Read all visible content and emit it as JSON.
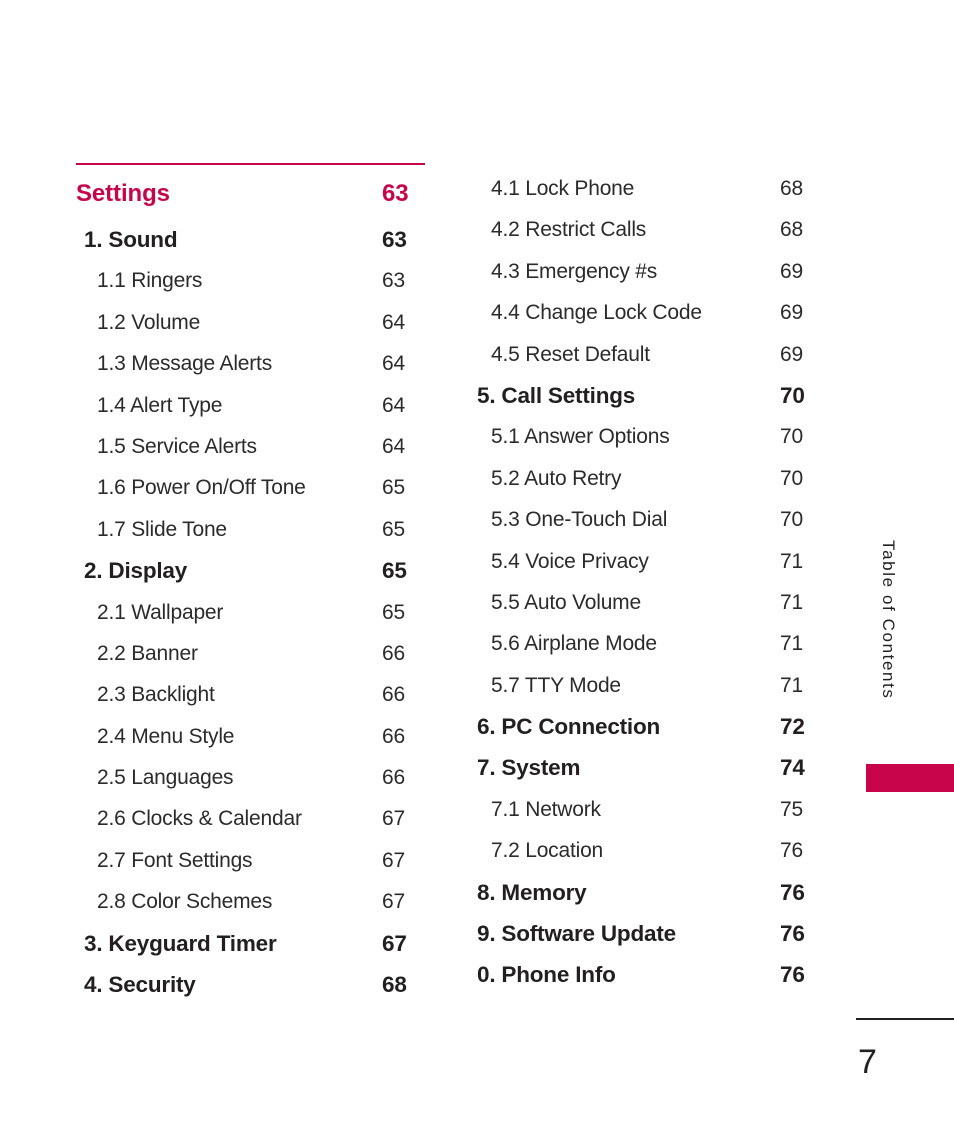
{
  "document": {
    "side_tab_label": "Table of Contents",
    "footer_page_number": "7",
    "accent_color": "#c8054b",
    "text_color": "#231f20"
  },
  "columns": {
    "left": [
      {
        "level": 0,
        "label": "Settings",
        "page": "63"
      },
      {
        "level": 1,
        "label": "1. Sound",
        "page": "63"
      },
      {
        "level": 2,
        "label": "1.1 Ringers",
        "page": "63"
      },
      {
        "level": 2,
        "label": "1.2 Volume",
        "page": "64"
      },
      {
        "level": 2,
        "label": "1.3 Message Alerts",
        "page": "64"
      },
      {
        "level": 2,
        "label": "1.4 Alert Type",
        "page": "64"
      },
      {
        "level": 2,
        "label": "1.5 Service Alerts",
        "page": "64"
      },
      {
        "level": 2,
        "label": "1.6 Power On/Off Tone",
        "page": "65"
      },
      {
        "level": 2,
        "label": "1.7 Slide Tone",
        "page": "65"
      },
      {
        "level": 1,
        "label": "2. Display",
        "page": "65"
      },
      {
        "level": 2,
        "label": "2.1 Wallpaper",
        "page": "65"
      },
      {
        "level": 2,
        "label": "2.2 Banner",
        "page": "66"
      },
      {
        "level": 2,
        "label": "2.3 Backlight",
        "page": "66"
      },
      {
        "level": 2,
        "label": "2.4 Menu Style",
        "page": "66"
      },
      {
        "level": 2,
        "label": "2.5 Languages",
        "page": "66"
      },
      {
        "level": 2,
        "label": "2.6 Clocks & Calendar",
        "page": "67"
      },
      {
        "level": 2,
        "label": "2.7 Font Settings",
        "page": "67"
      },
      {
        "level": 2,
        "label": "2.8 Color Schemes",
        "page": "67"
      },
      {
        "level": 1,
        "label": "3. Keyguard Timer",
        "page": "67"
      },
      {
        "level": 1,
        "label": "4. Security",
        "page": "68"
      }
    ],
    "right": [
      {
        "level": 2,
        "label": "4.1 Lock Phone",
        "page": "68"
      },
      {
        "level": 2,
        "label": "4.2 Restrict Calls",
        "page": "68"
      },
      {
        "level": 2,
        "label": "4.3 Emergency #s",
        "page": "69"
      },
      {
        "level": 2,
        "label": "4.4 Change Lock Code",
        "page": "69"
      },
      {
        "level": 2,
        "label": "4.5 Reset Default",
        "page": "69"
      },
      {
        "level": 1,
        "label": "5. Call Settings",
        "page": "70"
      },
      {
        "level": 2,
        "label": "5.1 Answer Options",
        "page": "70"
      },
      {
        "level": 2,
        "label": "5.2 Auto Retry",
        "page": "70"
      },
      {
        "level": 2,
        "label": "5.3 One-Touch Dial",
        "page": "70"
      },
      {
        "level": 2,
        "label": "5.4 Voice Privacy",
        "page": "71"
      },
      {
        "level": 2,
        "label": "5.5 Auto Volume",
        "page": "71"
      },
      {
        "level": 2,
        "label": "5.6 Airplane Mode",
        "page": "71"
      },
      {
        "level": 2,
        "label": "5.7 TTY Mode",
        "page": "71"
      },
      {
        "level": 1,
        "label": "6. PC Connection",
        "page": "72"
      },
      {
        "level": 1,
        "label": "7. System",
        "page": "74"
      },
      {
        "level": 2,
        "label": "7.1 Network",
        "page": "75"
      },
      {
        "level": 2,
        "label": "7.2 Location",
        "page": "76"
      },
      {
        "level": 1,
        "label": "8. Memory",
        "page": "76"
      },
      {
        "level": 1,
        "label": "9. Software Update",
        "page": "76"
      },
      {
        "level": 1,
        "label": "0. Phone Info",
        "page": "76"
      }
    ]
  }
}
